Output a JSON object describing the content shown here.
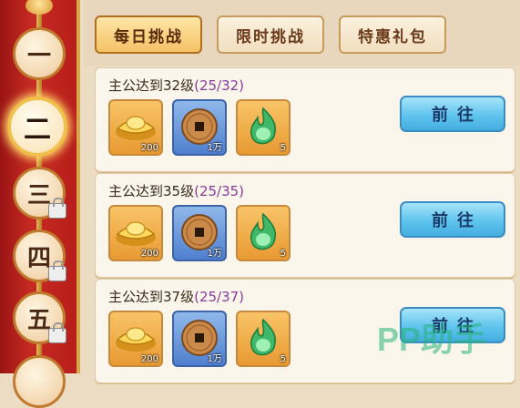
{
  "sidebar": {
    "days": [
      {
        "label": "一",
        "locked": false,
        "active": false
      },
      {
        "label": "二",
        "locked": false,
        "active": true
      },
      {
        "label": "三",
        "locked": true,
        "active": false
      },
      {
        "label": "四",
        "locked": true,
        "active": false
      },
      {
        "label": "五",
        "locked": true,
        "active": false
      }
    ]
  },
  "tabs": [
    {
      "label": "每日挑战",
      "active": true
    },
    {
      "label": "限时挑战",
      "active": false
    },
    {
      "label": "特惠礼包",
      "active": false
    }
  ],
  "tasks": [
    {
      "title": "主公达到32级",
      "progress": "(25/32)",
      "rewards": [
        {
          "icon": "gold-ingot-icon",
          "qty": "200"
        },
        {
          "icon": "copper-coin-icon",
          "qty": "1万"
        },
        {
          "icon": "green-flame-icon",
          "qty": "5"
        }
      ],
      "button": "前往"
    },
    {
      "title": "主公达到35级",
      "progress": "(25/35)",
      "rewards": [
        {
          "icon": "gold-ingot-icon",
          "qty": "200"
        },
        {
          "icon": "copper-coin-icon",
          "qty": "1万"
        },
        {
          "icon": "green-flame-icon",
          "qty": "5"
        }
      ],
      "button": "前往"
    },
    {
      "title": "主公达到37级",
      "progress": "(25/37)",
      "rewards": [
        {
          "icon": "gold-ingot-icon",
          "qty": "200"
        },
        {
          "icon": "copper-coin-icon",
          "qty": "1万"
        },
        {
          "icon": "green-flame-icon",
          "qty": "5"
        }
      ],
      "button": "前往"
    }
  ],
  "watermark": "PP助手"
}
